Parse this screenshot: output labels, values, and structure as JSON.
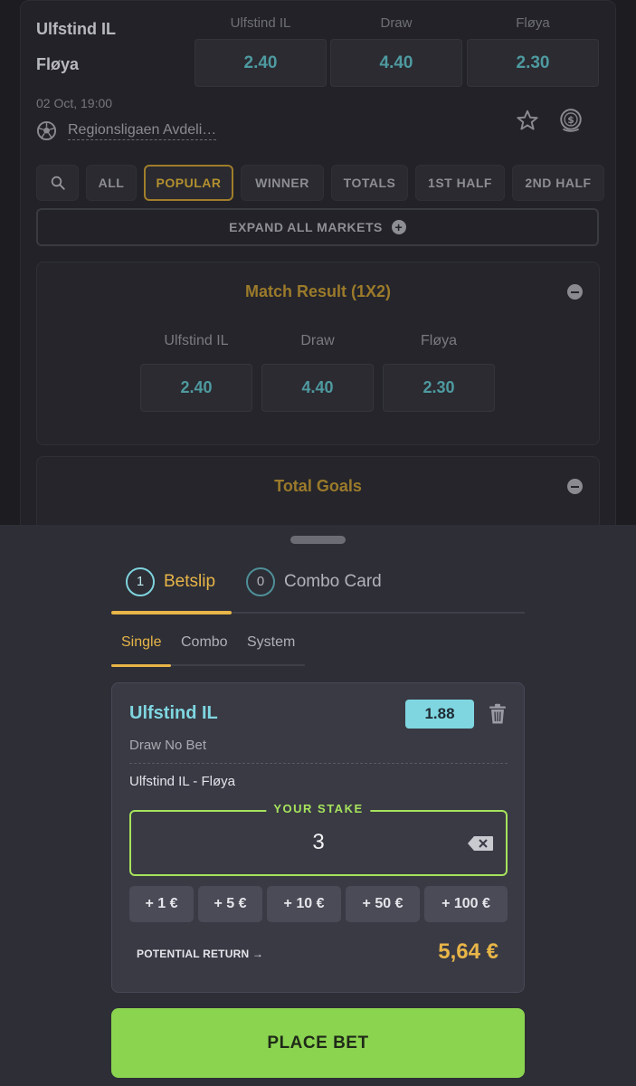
{
  "event": {
    "home_team": "Ulfstind IL",
    "away_team": "Fløya",
    "date": "02 Oct,  19:00",
    "league": "Regionsligaen Avdeli…",
    "odds_labels": [
      "Ulfstind IL",
      "Draw",
      "Fløya"
    ],
    "odds": [
      "2.40",
      "4.40",
      "2.30"
    ]
  },
  "filters": {
    "items": [
      "ALL",
      "POPULAR",
      "WINNER",
      "TOTALS",
      "1ST HALF",
      "2ND HALF"
    ],
    "active": "POPULAR",
    "expand_label": "EXPAND ALL MARKETS"
  },
  "markets": [
    {
      "title": "Match Result (1X2)",
      "labels": [
        "Ulfstind IL",
        "Draw",
        "Fløya"
      ],
      "odds": [
        "2.40",
        "4.40",
        "2.30"
      ]
    },
    {
      "title": "Total Goals"
    }
  ],
  "betslip": {
    "tabs": [
      {
        "count": "1",
        "label": "Betslip"
      },
      {
        "count": "0",
        "label": "Combo Card"
      }
    ],
    "sub_tabs": [
      "Single",
      "Combo",
      "System"
    ],
    "selection": {
      "name": "Ulfstind IL",
      "odds": "1.88",
      "market": "Draw No Bet",
      "event": "Ulfstind IL - Fløya"
    },
    "stake_label": "YOUR STAKE",
    "stake_value": "3",
    "quick_stakes": [
      "+ 1 €",
      "+ 5 €",
      "+ 10 €",
      "+ 50 €",
      "+ 100 €"
    ],
    "potential_return_label": "POTENTIAL RETURN →",
    "potential_return_value": "5,64 €",
    "place_bet_label": "PLACE BET"
  },
  "colors": {
    "accent_gold": "#e8b548",
    "accent_cyan": "#7fd6e0",
    "accent_green": "#8bd450"
  }
}
